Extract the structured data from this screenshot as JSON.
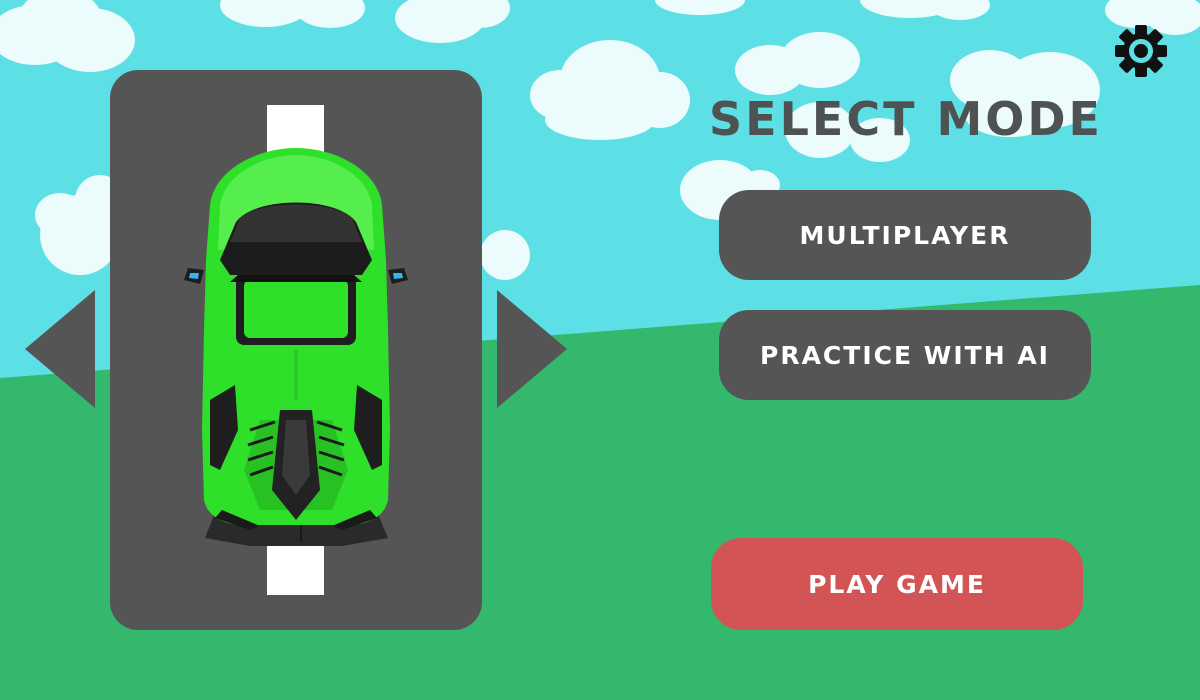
{
  "title": "SELECT MODE",
  "modes": [
    {
      "label": "MULTIPLAYER"
    },
    {
      "label": "PRACTICE WITH AI"
    }
  ],
  "play_button": {
    "label": "PLAY GAME"
  },
  "icons": {
    "settings": "gear-icon",
    "previous_car": "arrow-left-icon",
    "next_car": "arrow-right-icon"
  },
  "colors": {
    "sky": "#5ddfe6",
    "grass": "#33b86d",
    "panel": "#555555",
    "play_button": "#d35454",
    "car_body": "#2fe02a",
    "title_text": "#4f5252"
  }
}
